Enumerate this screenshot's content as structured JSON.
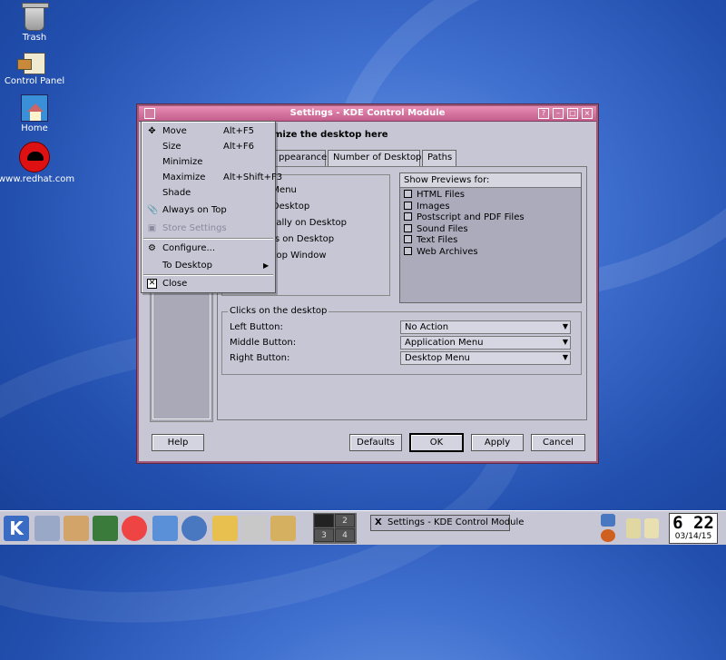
{
  "desktop": {
    "icons": [
      {
        "label": "Trash"
      },
      {
        "label": "Control Panel"
      },
      {
        "label": "Home"
      },
      {
        "label": "www.redhat.com"
      }
    ]
  },
  "window": {
    "title": "Settings - KDE Control Module",
    "header": "mize the desktop here",
    "tabs": [
      "ppearance",
      "Number of Desktops",
      "Paths"
    ],
    "left_group_title": "s",
    "options": [
      "Desktop Menu",
      "Icons on Desktop",
      "ons Vertically on Desktop",
      "idden Files on Desktop",
      "s in Desktop Window"
    ],
    "previews": {
      "header": "Show Previews for:",
      "items": [
        "HTML Files",
        "Images",
        "Postscript and PDF Files",
        "Sound Files",
        "Text Files",
        "Web Archives"
      ]
    },
    "clicks": {
      "title": "Clicks on the desktop",
      "rows": [
        {
          "label": "Left Button:",
          "value": "No Action"
        },
        {
          "label": "Middle Button:",
          "value": "Application Menu"
        },
        {
          "label": "Right Button:",
          "value": "Desktop Menu"
        }
      ]
    },
    "buttons": {
      "help": "Help",
      "defaults": "Defaults",
      "ok": "OK",
      "apply": "Apply",
      "cancel": "Cancel"
    }
  },
  "menu": {
    "items": [
      {
        "label": "Move",
        "accel": "Alt+F5",
        "icon": "move-icon"
      },
      {
        "label": "Size",
        "accel": "Alt+F6"
      },
      {
        "label": "Minimize",
        "accel": ""
      },
      {
        "label": "Maximize",
        "accel": "Alt+Shift+F3"
      },
      {
        "label": "Shade",
        "accel": ""
      },
      {
        "label": "Always on Top",
        "accel": "",
        "icon": "pin-icon"
      },
      {
        "label": "Store Settings",
        "accel": "",
        "icon": "save-icon",
        "disabled": true
      },
      {
        "label": "Configure...",
        "accel": "",
        "icon": "configure-icon"
      },
      {
        "label": "To Desktop",
        "accel": "",
        "submenu": true
      },
      {
        "label": "Close",
        "accel": "",
        "icon": "close-icon"
      }
    ]
  },
  "taskbar": {
    "pager": [
      "1",
      "2",
      "3",
      "4"
    ],
    "task_label": "Settings - KDE Control Module",
    "clock_time": "6 22",
    "clock_date": "03/14/15"
  }
}
